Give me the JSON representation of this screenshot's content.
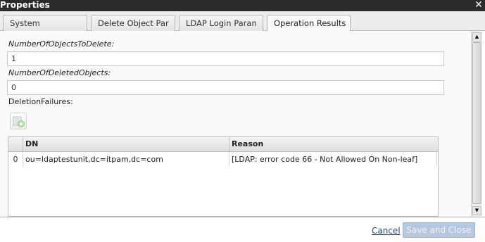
{
  "window": {
    "title": "Properties",
    "close_glyph": "✕",
    "close_icon": "close-icon"
  },
  "tabs": [
    {
      "label": "System",
      "active": false
    },
    {
      "label": "Delete Object Par",
      "active": false
    },
    {
      "label": "LDAP Login Paran",
      "active": false
    },
    {
      "label": "Operation Results",
      "active": true
    }
  ],
  "fields": {
    "objects_to_delete": {
      "label": "NumberOfObjectsToDelete:",
      "value": "1"
    },
    "deleted_objects": {
      "label": "NumberOfDeletedObjects:",
      "value": "0"
    },
    "deletion_failures": {
      "label": "DeletionFailures:"
    }
  },
  "add_button": {
    "icon": "add-row-icon"
  },
  "failures_table": {
    "columns": [
      "DN",
      "Reason"
    ],
    "rows": [
      {
        "index": "0",
        "dn": "ou=ldaptestunit,dc=itpam,dc=com",
        "reason": "[LDAP: error code 66 - Not Allowed On Non-leaf]"
      }
    ]
  },
  "scrollbar": {
    "up_glyph": "▲",
    "down_glyph": "▼"
  },
  "footer": {
    "cancel_label": "Cancel",
    "save_label": "Save and Close",
    "save_enabled": false
  },
  "colors": {
    "titlebar": "#2b2b2b",
    "link": "#1a4fa0",
    "disabled_button": "#b7c8de"
  }
}
